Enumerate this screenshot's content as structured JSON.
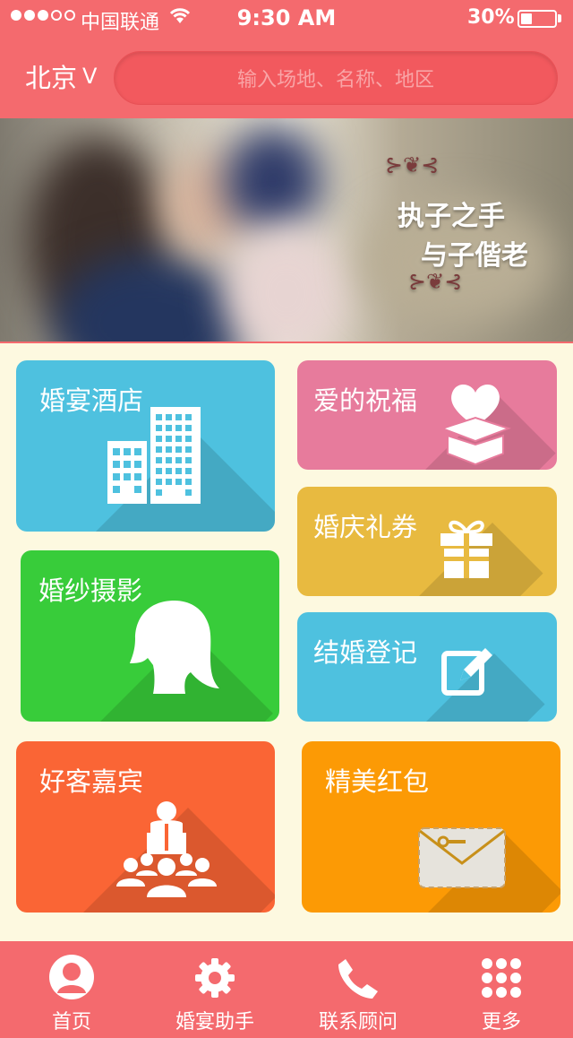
{
  "status_bar": {
    "carrier": "中国联通",
    "time": "9:30 AM",
    "battery": "30%"
  },
  "header": {
    "city": "北京",
    "city_chevron": "V",
    "search_placeholder": "输入场地、名称、地区"
  },
  "banner": {
    "line1": "执子之手",
    "line2": "与子偕老"
  },
  "tiles": [
    {
      "label": "婚宴酒店",
      "icon": "hotel-buildings-icon",
      "color": "#4ec1df"
    },
    {
      "label": "爱的祝福",
      "icon": "heart-gift-box-icon",
      "color": "#e77b9c"
    },
    {
      "label": "婚庆礼券",
      "icon": "gift-icon",
      "color": "#e8ba40"
    },
    {
      "label": "婚纱摄影",
      "icon": "woman-head-icon",
      "color": "#38cc3a"
    },
    {
      "label": "结婚登记",
      "icon": "edit-form-icon",
      "color": "#4ec1df"
    },
    {
      "label": "好客嘉宾",
      "icon": "speaker-audience-icon",
      "color": "#fa6535"
    },
    {
      "label": "精美红包",
      "icon": "envelope-icon",
      "color": "#fc9a05"
    }
  ],
  "nav": [
    {
      "label": "首页",
      "icon": "person-icon"
    },
    {
      "label": "婚宴助手",
      "icon": "gear-icon"
    },
    {
      "label": "联系顾问",
      "icon": "phone-icon"
    },
    {
      "label": "更多",
      "icon": "grid-dots-icon"
    }
  ],
  "colors": {
    "header": "#f46a6e",
    "background": "#fdf9e0"
  }
}
